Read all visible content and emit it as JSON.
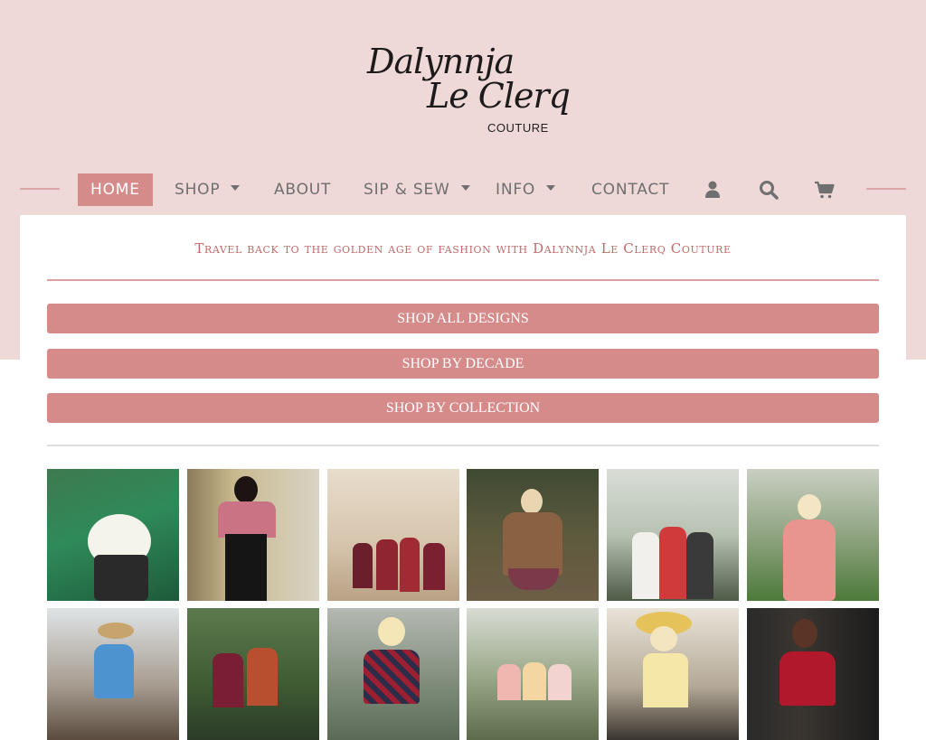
{
  "brand": {
    "logo_line1": "Dalynnja",
    "logo_line2": "Le Clerq",
    "logo_line3": "COUTURE"
  },
  "nav": {
    "items": [
      {
        "label": "HOME",
        "active": true
      },
      {
        "label": "SHOP",
        "dropdown": true
      },
      {
        "label": "ABOUT"
      },
      {
        "label": "SIP & SEW",
        "dropdown": true
      },
      {
        "label": "INFO",
        "dropdown": true
      },
      {
        "label": "CONTACT"
      }
    ],
    "icons": [
      "user-icon",
      "search-icon",
      "cart-icon"
    ]
  },
  "hero": {
    "tagline": "Travel back to the golden age of fashion with Dalynnja Le Clerq Couture"
  },
  "shop_buttons": [
    "SHOP ALL DESIGNS",
    "SHOP BY DECADE",
    "SHOP BY COLLECTION"
  ],
  "gallery": {
    "images": [
      "green-floral-dress-photo",
      "pink-black-suit-photo",
      "group-in-salon-photo",
      "brown-coat-photo",
      "three-women-greenhouse-photo",
      "pink-dress-garden-photo",
      "blue-dress-rocks-photo",
      "two-women-gate-photo",
      "tartan-dress-photo",
      "group-in-park-photo",
      "floral-dress-sunhat-photo",
      "red-dress-doorway-photo"
    ]
  },
  "colors": {
    "hero_bg": "#efd8d8",
    "accent": "#d68b8b",
    "tagline": "#c06a6a"
  }
}
